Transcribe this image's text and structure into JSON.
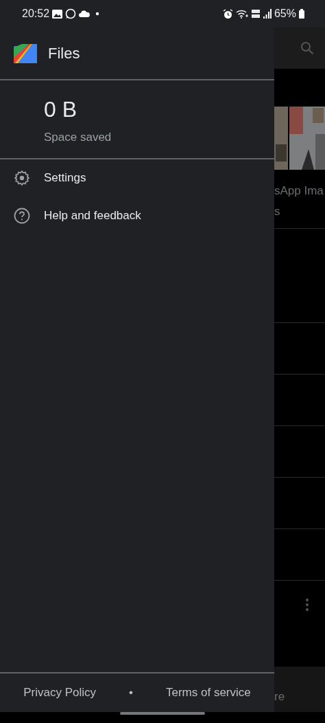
{
  "status_bar": {
    "time": "20:52",
    "battery": "65%"
  },
  "drawer": {
    "app_title": "Files",
    "saved_amount": "0 B",
    "saved_label": "Space saved",
    "items": [
      {
        "kind": "settings",
        "label": "Settings"
      },
      {
        "kind": "help",
        "label": "Help and feedback"
      }
    ],
    "footer_links": [
      "Privacy Policy",
      "Terms of service"
    ],
    "footer_separator": "•"
  },
  "background": {
    "card_title": "sApp Ima",
    "card_subtitle": "s",
    "nav_label": "re"
  }
}
